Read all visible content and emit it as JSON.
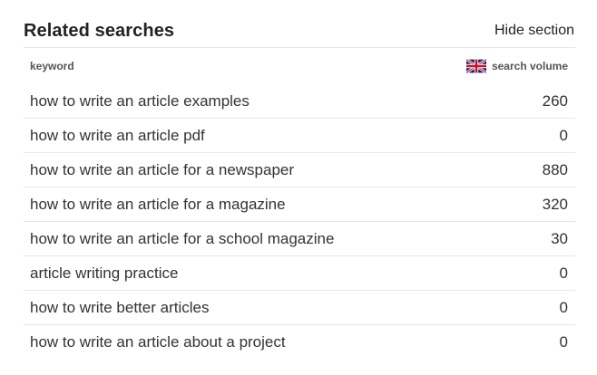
{
  "section": {
    "title": "Related searches",
    "hide_label": "Hide section"
  },
  "columns": {
    "keyword": "keyword",
    "volume": "search volume",
    "flag_icon": "uk-flag-icon"
  },
  "rows": [
    {
      "keyword": "how to write an article examples",
      "volume": "260"
    },
    {
      "keyword": "how to write an article pdf",
      "volume": "0"
    },
    {
      "keyword": "how to write an article for a newspaper",
      "volume": "880"
    },
    {
      "keyword": "how to write an article for a magazine",
      "volume": "320"
    },
    {
      "keyword": "how to write an article for a school magazine",
      "volume": "30"
    },
    {
      "keyword": "article writing practice",
      "volume": "0"
    },
    {
      "keyword": "how to write better articles",
      "volume": "0"
    },
    {
      "keyword": "how to write an article about a project",
      "volume": "0"
    }
  ]
}
